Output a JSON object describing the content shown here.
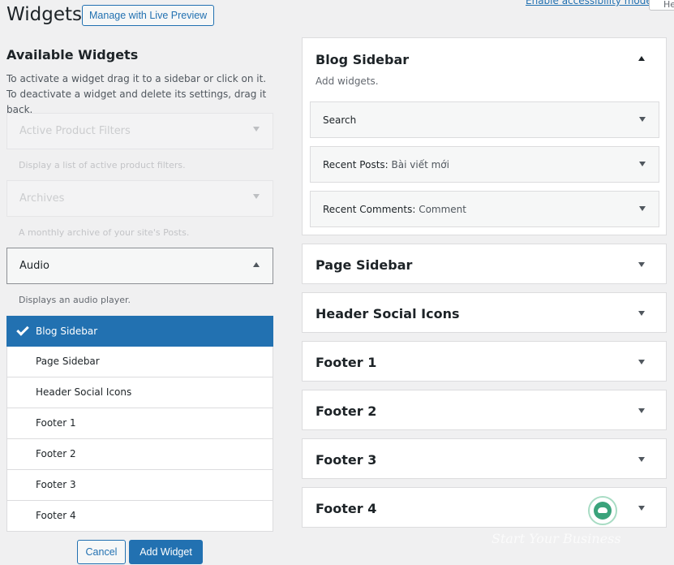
{
  "header": {
    "accessibility_link": "Enable accessibility mode",
    "help_tab": "He",
    "title": "Widgets",
    "preview_button": "Manage with Live Preview"
  },
  "available": {
    "title": "Available Widgets",
    "description": "To activate a widget drag it to a sidebar or click on it. To deactivate a widget and delete its settings, drag it back.",
    "widgets": [
      {
        "title": "Active Product Filters",
        "description": "Display a list of active product filters."
      },
      {
        "title": "Archives",
        "description": "A monthly archive of your site's Posts."
      },
      {
        "title": "Audio",
        "description": "Displays an audio player."
      }
    ],
    "chooser": [
      "Blog Sidebar",
      "Page Sidebar",
      "Header Social Icons",
      "Footer 1",
      "Footer 2",
      "Footer 3",
      "Footer 4"
    ],
    "cancel_label": "Cancel",
    "add_label": "Add Widget"
  },
  "sidebars": {
    "blog": {
      "title": "Blog Sidebar",
      "description": "Add widgets.",
      "widgets": [
        {
          "title": "Search",
          "subtitle": ""
        },
        {
          "title": "Recent Posts:",
          "subtitle": "Bài viết mới"
        },
        {
          "title": "Recent Comments:",
          "subtitle": "Comment"
        }
      ]
    },
    "others": [
      "Page Sidebar",
      "Header Social Icons",
      "Footer 1",
      "Footer 2",
      "Footer 3",
      "Footer 4"
    ]
  },
  "watermark": "Start Your Business"
}
